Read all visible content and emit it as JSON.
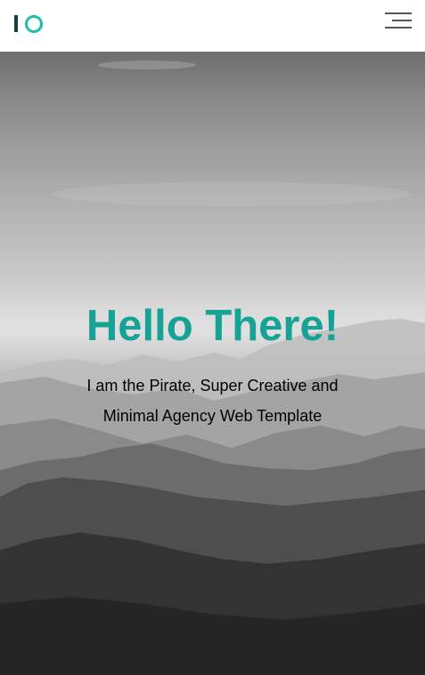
{
  "header": {
    "logo_icon": "io-logo-icon",
    "menu_icon": "hamburger-menu-icon"
  },
  "hero": {
    "title": "Hello There!",
    "subtitle_line1": "I am the Pirate, Super Creative and",
    "subtitle_line2": "Minimal Agency Web Template",
    "background": "grayscale-mountain-landscape-image"
  },
  "colors": {
    "accent": "#16a396",
    "logo_ring": "#1dbfa9",
    "logo_bar": "#1c3b47",
    "text": "#000000",
    "header_bg": "#ffffff"
  }
}
